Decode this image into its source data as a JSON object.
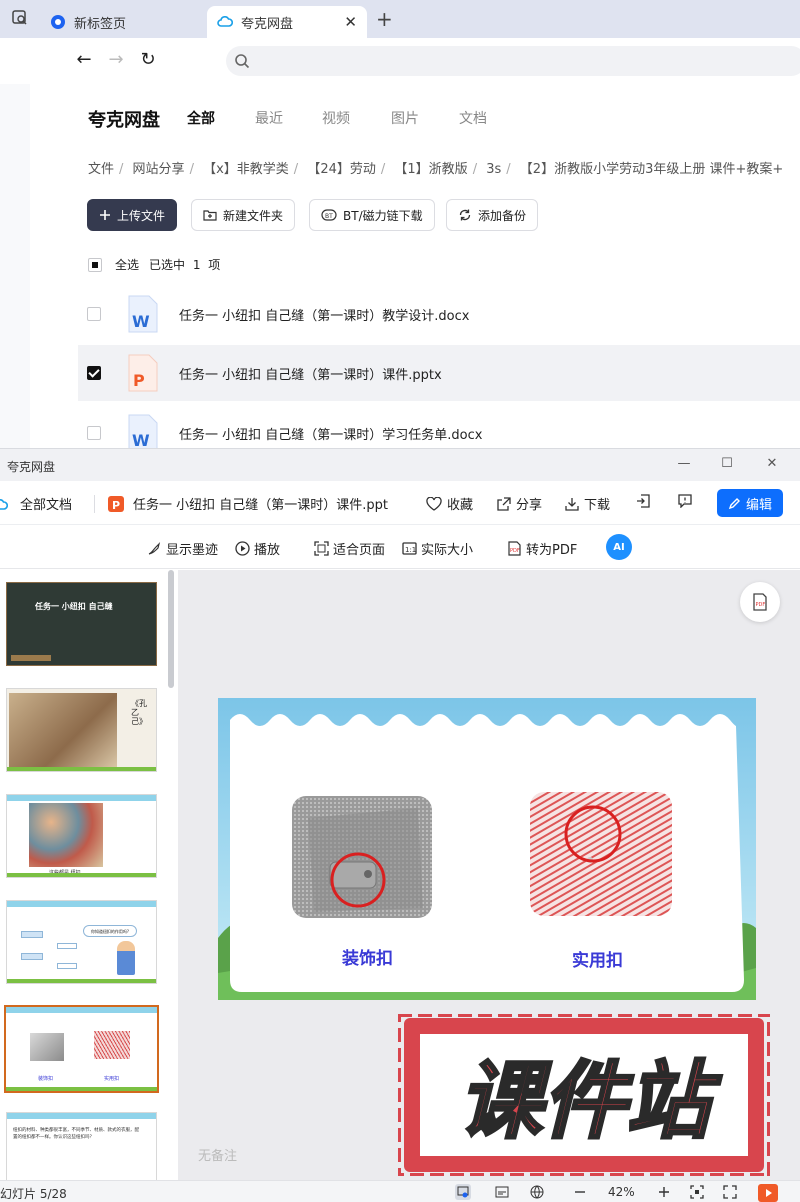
{
  "browser": {
    "tabs": [
      {
        "label": "新标签页"
      },
      {
        "label": "夸克网盘"
      }
    ]
  },
  "drive": {
    "brand": "夸克网盘",
    "nav_tabs": [
      "全部",
      "最近",
      "视频",
      "图片",
      "文档"
    ],
    "breadcrumb": [
      "文件",
      "网站分享",
      "【x】非教学类",
      "【24】劳动",
      "【1】浙教版",
      "3s",
      "【2】浙教版小学劳动3年级上册 课件+教案+"
    ],
    "buttons": {
      "upload": "上传文件",
      "new_folder": "新建文件夹",
      "bt_download": "BT/磁力链下载",
      "add_backup": "添加备份"
    },
    "select_all": "全选",
    "selected_count": "已选中 1 项",
    "files": [
      {
        "name": "任务一 小纽扣 自己缝（第一课时）教学设计.docx",
        "type": "docx",
        "checked": false
      },
      {
        "name": "任务一 小纽扣 自己缝（第一课时）课件.pptx",
        "type": "pptx",
        "checked": true
      },
      {
        "name": "任务一 小纽扣 自己缝（第一课时）学习任务单.docx",
        "type": "docx",
        "checked": false
      }
    ]
  },
  "viewer": {
    "window_title": "夸克网盘",
    "all_docs": "全部文档",
    "doc_title": "任务一 小纽扣 自己缝（第一课时）课件.ppt",
    "actions": {
      "favorite": "收藏",
      "share": "分享",
      "download": "下载",
      "edit": "编辑"
    },
    "tools": {
      "show_ink": "显示墨迹",
      "play": "播放",
      "fit_page": "适合页面",
      "actual_size": "实际大小",
      "to_pdf": "转为PDF",
      "ai": "AI"
    },
    "thumbnails": {
      "slide1_title": "任务一 小纽扣 自己缝",
      "slide2_text": "《孔乙己》",
      "slide3_caption": "这些都是 纽扣",
      "slide4_bubble": "你知道纽扣的作用吗?",
      "slide5_labels": [
        "装饰扣",
        "实用扣"
      ],
      "slide6_text": "纽扣的材料、种类都很丰富，不同季节、材质、款式的衣服，配置的纽扣都不一样。你认识这些纽扣吗？"
    },
    "slide": {
      "label_left": "装饰扣",
      "label_right": "实用扣"
    },
    "notes_placeholder": "无备注",
    "status": "幻灯片 5/28",
    "zoom": "42%",
    "watermark": "课件站"
  },
  "colors": {
    "accent_blue": "#0d6efd",
    "upload_btn": "#353a4f",
    "slide_label": "#3a3ad6",
    "watermark_red": "#d8454d",
    "ppt_orange": "#f05a28",
    "word_blue": "#2b6cd4"
  }
}
